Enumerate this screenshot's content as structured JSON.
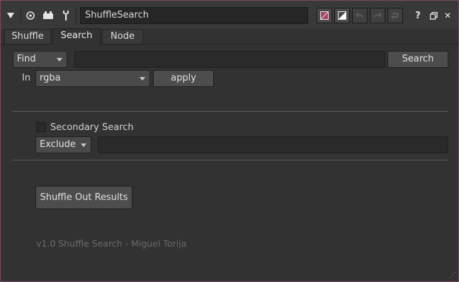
{
  "titlebar": {
    "node_name": "ShuffleSearch",
    "icons": [
      "collapse-arrow-icon",
      "viewer-icon",
      "render-icon",
      "wrench-icon",
      "node-color-icon",
      "node-gl-color-icon",
      "undo-icon",
      "redo-icon",
      "revert-icon",
      "help-icon",
      "float-icon",
      "close-icon"
    ],
    "help_label": "?",
    "close_label": "✕",
    "colors": {
      "node_color": "#b0406a",
      "gl_color": "#ffffff",
      "border": "#7c4a62"
    }
  },
  "tabs": [
    {
      "label": "Shuffle",
      "active": false
    },
    {
      "label": "Search",
      "active": true
    },
    {
      "label": "Node",
      "active": false
    }
  ],
  "search": {
    "mode_value": "Find",
    "query_value": "",
    "search_button_label": "Search",
    "in_label": "In",
    "layer_value": "rgba",
    "apply_button_label": "apply"
  },
  "secondary": {
    "checkbox_label": "Secondary Search",
    "checked": false,
    "mode_value": "Exclude",
    "query_value": ""
  },
  "actions": {
    "shuffle_out_label": "Shuffle Out Results"
  },
  "footer": {
    "version_text": "v1.0 Shuffle Search - Miguel Torija"
  }
}
